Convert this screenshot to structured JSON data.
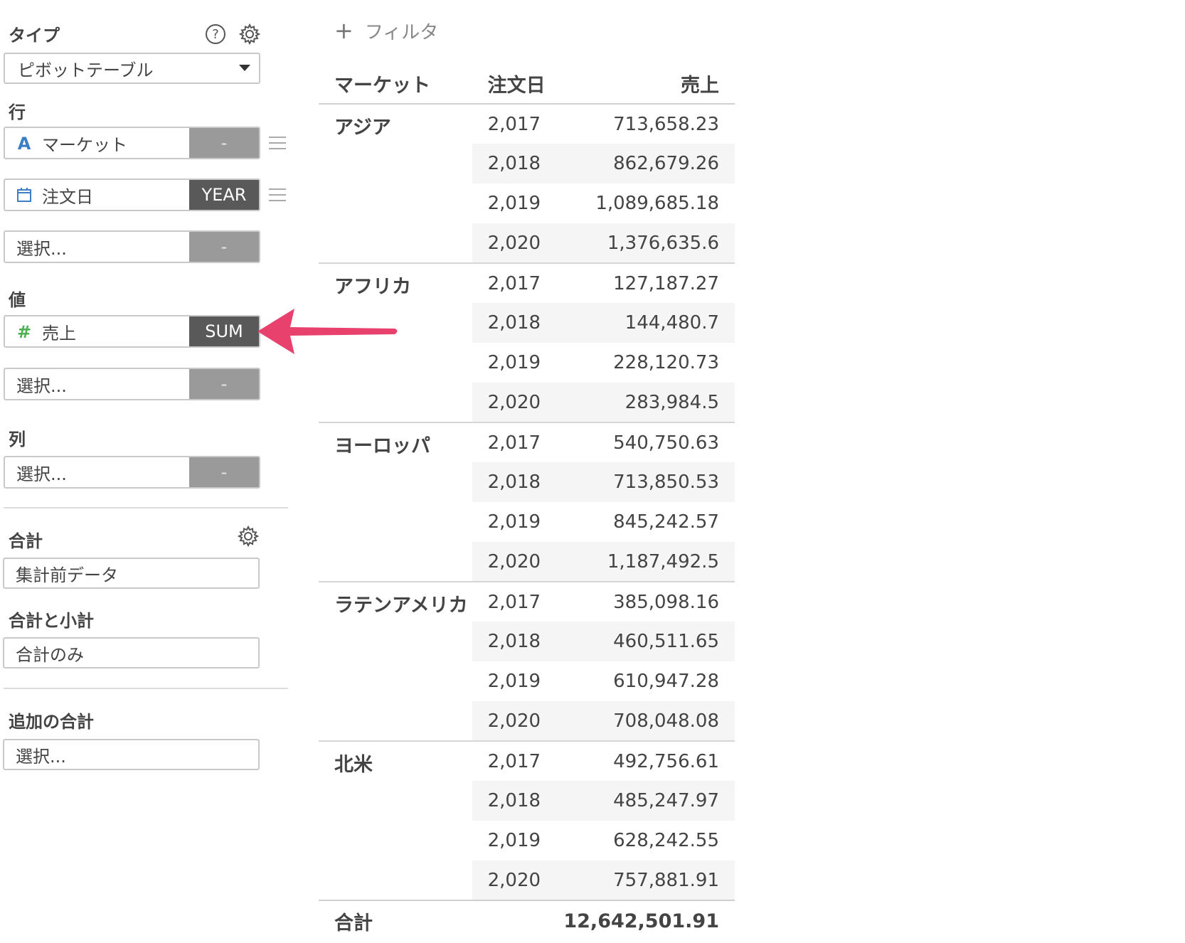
{
  "panel": {
    "type_label": "タイプ",
    "type_value": "ピボットテーブル",
    "rows_label": "行",
    "rows": [
      {
        "name": "マーケット",
        "icon": "text-type-icon",
        "agg": "-"
      },
      {
        "name": "注文日",
        "icon": "calendar-icon",
        "agg": "YEAR"
      },
      {
        "name": "選択...",
        "icon": "",
        "agg": "-"
      }
    ],
    "values_label": "値",
    "values": [
      {
        "name": "売上",
        "icon": "number-type-icon",
        "agg": "SUM"
      },
      {
        "name": "選択...",
        "icon": "",
        "agg": "-"
      }
    ],
    "columns_label": "列",
    "columns": [
      {
        "name": "選択...",
        "icon": "",
        "agg": "-"
      }
    ],
    "total_label": "合計",
    "total_value": "集計前データ",
    "subtotal_label": "合計と小計",
    "subtotal_value": "合計のみ",
    "extra_total_label": "追加の合計",
    "extra_total_value": "選択..."
  },
  "filter": {
    "plus": "+",
    "label": "フィルタ"
  },
  "table": {
    "headers": [
      "マーケット",
      "注文日",
      "売上"
    ],
    "groups": [
      {
        "market": "アジア",
        "rows": [
          [
            "2,017",
            "713,658.23"
          ],
          [
            "2,018",
            "862,679.26"
          ],
          [
            "2,019",
            "1,089,685.18"
          ],
          [
            "2,020",
            "1,376,635.6"
          ]
        ]
      },
      {
        "market": "アフリカ",
        "rows": [
          [
            "2,017",
            "127,187.27"
          ],
          [
            "2,018",
            "144,480.7"
          ],
          [
            "2,019",
            "228,120.73"
          ],
          [
            "2,020",
            "283,984.5"
          ]
        ]
      },
      {
        "market": "ヨーロッパ",
        "rows": [
          [
            "2,017",
            "540,750.63"
          ],
          [
            "2,018",
            "713,850.53"
          ],
          [
            "2,019",
            "845,242.57"
          ],
          [
            "2,020",
            "1,187,492.5"
          ]
        ]
      },
      {
        "market": "ラテンアメリカ",
        "rows": [
          [
            "2,017",
            "385,098.16"
          ],
          [
            "2,018",
            "460,511.65"
          ],
          [
            "2,019",
            "610,947.28"
          ],
          [
            "2,020",
            "708,048.08"
          ]
        ]
      },
      {
        "market": "北米",
        "rows": [
          [
            "2,017",
            "492,756.61"
          ],
          [
            "2,018",
            "485,247.97"
          ],
          [
            "2,019",
            "628,242.55"
          ],
          [
            "2,020",
            "757,881.91"
          ]
        ]
      }
    ],
    "total_label": "合計",
    "total_value": "12,642,501.91"
  },
  "colors": {
    "accent_arrow": "#e8416e",
    "text_type_icon": "#3d7fc4",
    "number_type_icon": "#4caf50",
    "calendar_icon": "#3d7fc4"
  }
}
